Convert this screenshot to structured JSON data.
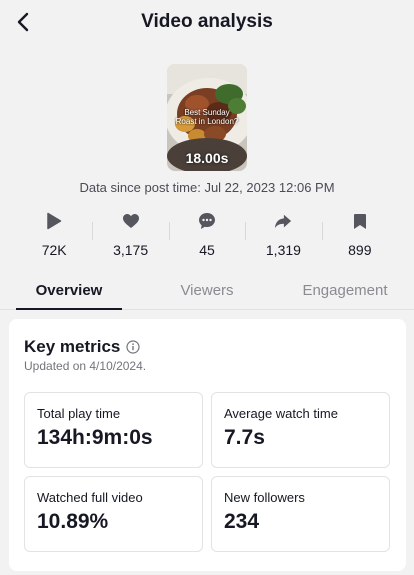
{
  "header": {
    "title": "Video analysis"
  },
  "video": {
    "overlay_text": "Best Sunday Roast in London?",
    "duration": "18.00s"
  },
  "data_since": "Data since post time: Jul 22, 2023 12:06 PM",
  "stats": [
    {
      "icon": "play-icon",
      "value": "72K"
    },
    {
      "icon": "heart-icon",
      "value": "3,175"
    },
    {
      "icon": "comment-icon",
      "value": "45"
    },
    {
      "icon": "share-icon",
      "value": "1,319"
    },
    {
      "icon": "bookmark-icon",
      "value": "899"
    }
  ],
  "tabs": [
    {
      "label": "Overview",
      "active": true
    },
    {
      "label": "Viewers",
      "active": false
    },
    {
      "label": "Engagement",
      "active": false
    }
  ],
  "key_metrics": {
    "title": "Key metrics",
    "updated": "Updated on 4/10/2024.",
    "items": [
      {
        "label": "Total play time",
        "value": "134h:9m:0s"
      },
      {
        "label": "Average watch time",
        "value": "7.7s"
      },
      {
        "label": "Watched full video",
        "value": "10.89%"
      },
      {
        "label": "New followers",
        "value": "234"
      }
    ]
  },
  "colors": {
    "background": "#f2f2f3",
    "text": "#161823",
    "muted": "#8a8b91",
    "icon": "#55565e"
  }
}
